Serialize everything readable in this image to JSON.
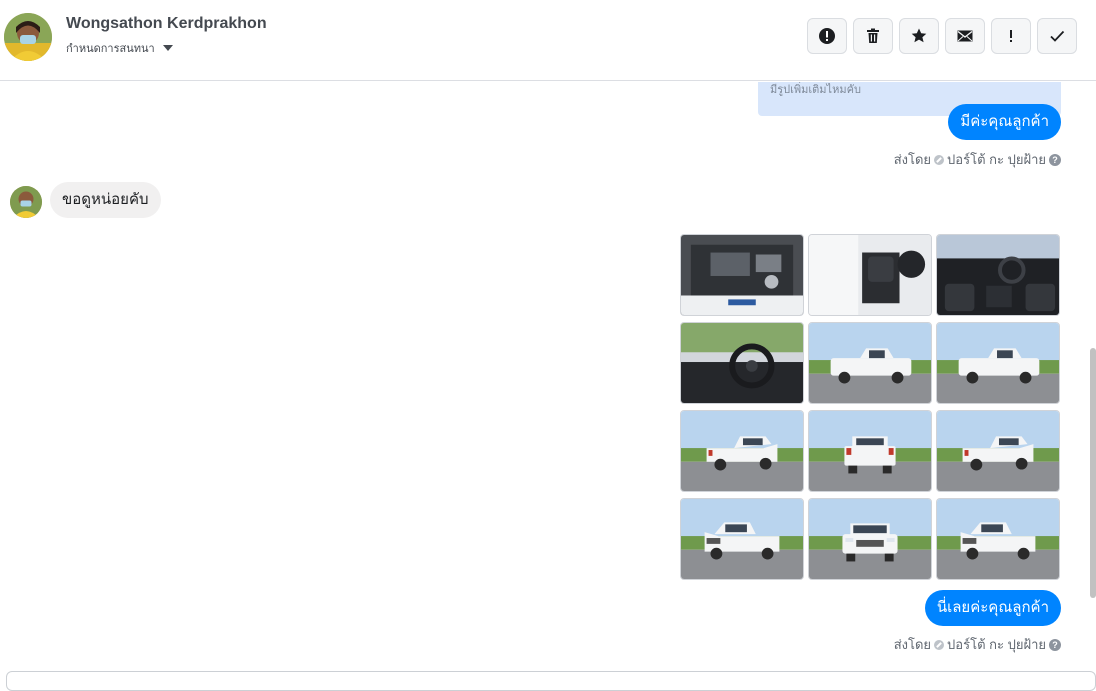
{
  "header": {
    "name": "Wongsathon Kerdprakhon",
    "subtitle": "กำหนดการสนทนา"
  },
  "toolbar": [
    {
      "name": "spam-button",
      "icon": "alert-circle-icon"
    },
    {
      "name": "delete-button",
      "icon": "trash-icon"
    },
    {
      "name": "star-button",
      "icon": "star-icon"
    },
    {
      "name": "mark-unread-button",
      "icon": "envelope-icon"
    },
    {
      "name": "priority-button",
      "icon": "exclamation-icon"
    },
    {
      "name": "done-button",
      "icon": "check-icon"
    }
  ],
  "messages": {
    "quoted_text": "มีรูปเพิ่มเติมไหมคับ",
    "reply1": "มีค่ะคุณลูกค้า",
    "sent_by_label": "ส่งโดย",
    "sender": "ปอร์โต้ กะ ปุยฝ้าย",
    "incoming": "ขอดูหน่อยคับ",
    "reply2": "นี่เลยค่ะคุณลูกค้า"
  },
  "photos": [
    {
      "name": "engine-bay",
      "scene": "engine"
    },
    {
      "name": "driver-seat",
      "scene": "seat"
    },
    {
      "name": "dashboard",
      "scene": "dash"
    },
    {
      "name": "steering-wheel",
      "scene": "wheel"
    },
    {
      "name": "truck-side-left",
      "scene": "side"
    },
    {
      "name": "truck-side-right",
      "scene": "side"
    },
    {
      "name": "truck-rear-angle",
      "scene": "rear-angle"
    },
    {
      "name": "truck-rear",
      "scene": "rear"
    },
    {
      "name": "truck-rear-right",
      "scene": "rear-angle"
    },
    {
      "name": "truck-front-angle",
      "scene": "front-angle"
    },
    {
      "name": "truck-front",
      "scene": "front"
    },
    {
      "name": "truck-front-right",
      "scene": "front-angle"
    }
  ],
  "colors": {
    "accent": "#0084ff",
    "quoted_bg": "#d8e6fb"
  }
}
